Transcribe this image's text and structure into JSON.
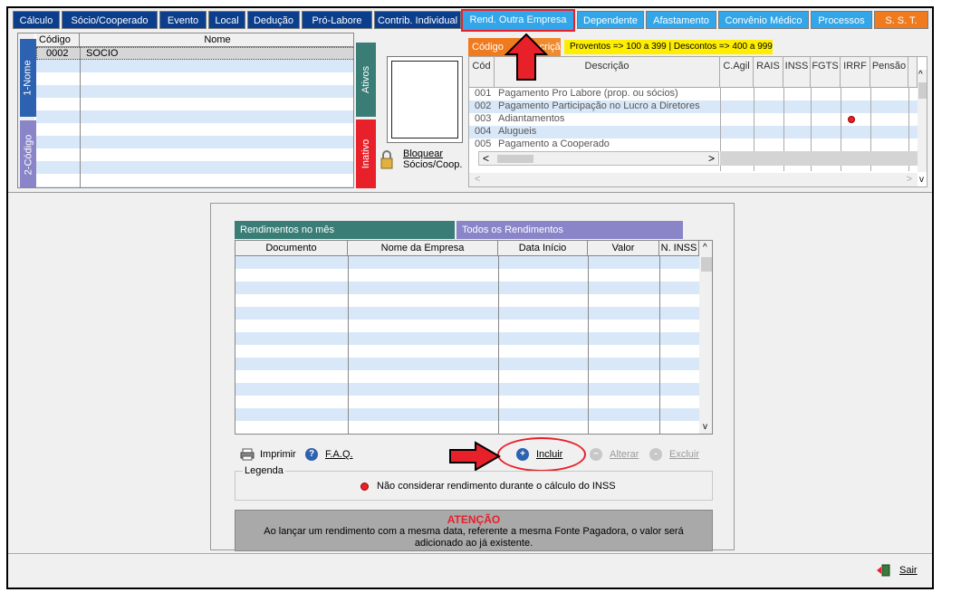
{
  "tabs": [
    {
      "label": "Cálculo",
      "style": "dark"
    },
    {
      "label": "Sócio/Cooperado",
      "style": "dark"
    },
    {
      "label": "Evento",
      "style": "dark"
    },
    {
      "label": "Local",
      "style": "dark"
    },
    {
      "label": "Dedução",
      "style": "dark"
    },
    {
      "label": "Pró-Labore",
      "style": "dark"
    },
    {
      "label": "Contrib. Individual",
      "style": "dark"
    },
    {
      "label": "Rend. Outra Empresa",
      "style": "active"
    },
    {
      "label": "Dependente",
      "style": "light"
    },
    {
      "label": "Afastamento",
      "style": "light"
    },
    {
      "label": "Convênio Médico",
      "style": "light"
    },
    {
      "label": "Processos",
      "style": "light"
    },
    {
      "label": "S. S. T.",
      "style": "orange"
    }
  ],
  "socios": {
    "headers": {
      "codigo": "Código",
      "nome": "Nome"
    },
    "rows": [
      {
        "codigo": "0002",
        "nome": "SOCIO"
      }
    ],
    "side_tabs": {
      "nome": "1-Nome",
      "codigo": "2-Código"
    },
    "status_tabs": {
      "ativos": "Ativos",
      "inativo": "Inativo"
    }
  },
  "bloquear_label_1": "Bloquear",
  "bloquear_label_2": "Sócios/Coop.",
  "eventos": {
    "tab_codigo": "Código",
    "tab_descricao": "Descrição",
    "legend": "Proventos => 100 a 399 | Descontos => 400 a 999",
    "headers": [
      "Cód",
      "Descrição",
      "C.Agil",
      "RAIS",
      "INSS",
      "FGTS",
      "IRRF",
      "Pensão"
    ],
    "rows": [
      {
        "cod": "001",
        "descricao": "Pagamento Pro Labore (prop. ou sócios)",
        "irrf": false
      },
      {
        "cod": "002",
        "descricao": "Pagamento Participação no Lucro a Diretores",
        "irrf": false
      },
      {
        "cod": "003",
        "descricao": "Adiantamentos",
        "irrf": true
      },
      {
        "cod": "004",
        "descricao": "Alugueis",
        "irrf": false
      },
      {
        "cod": "005",
        "descricao": "Pagamento a Cooperado",
        "irrf": false
      }
    ]
  },
  "rendimentos": {
    "tab_mes": "Rendimentos no mês",
    "tab_todos": "Todos os Rendimentos",
    "headers": [
      "Documento",
      "Nome da Empresa",
      "Data Início",
      "Valor",
      "N. INSS"
    ],
    "buttons": {
      "imprimir": "Imprimir",
      "faq": "F.A.Q.",
      "incluir": "Incluir",
      "alterar": "Alterar",
      "excluir": "Excluir"
    },
    "legenda_title": "Legenda",
    "legenda_text": "Não considerar rendimento durante o cálculo do INSS",
    "atencao_title": "ATENÇÃO",
    "atencao_line1": "Ao lançar um rendimento com a mesma data, referente a mesma Fonte Pagadora, o valor será",
    "atencao_line2": "adicionado ao já existente."
  },
  "sair": "Sair",
  "colors": {
    "tab_dark": "#0b3e8c",
    "tab_light": "#32a6e8",
    "tab_orange": "#f07a1e",
    "highlight_red": "#e8202a",
    "row_stripe": "#d9e8f8",
    "teal": "#3a7d77",
    "lavender": "#8a85c9"
  }
}
